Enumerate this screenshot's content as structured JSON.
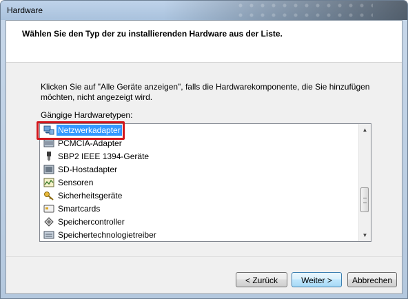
{
  "window": {
    "title": "Hardware"
  },
  "header": {
    "title": "Wählen Sie den Typ der zu installierenden Hardware aus der Liste."
  },
  "instruction": "Klicken Sie auf \"Alle Geräte anzeigen\", falls die Hardwarekomponente, die Sie hinzufügen möchten, nicht angezeigt wird.",
  "list": {
    "label": "Gängige Hardwaretypen:",
    "items": [
      {
        "label": "Netzwerkadapter",
        "icon": "network-adapter-icon",
        "selected": true
      },
      {
        "label": "PCMCIA-Adapter",
        "icon": "pcmcia-icon",
        "selected": false
      },
      {
        "label": "SBP2 IEEE 1394-Geräte",
        "icon": "ieee1394-icon",
        "selected": false
      },
      {
        "label": "SD-Hostadapter",
        "icon": "sd-host-icon",
        "selected": false
      },
      {
        "label": "Sensoren",
        "icon": "sensor-icon",
        "selected": false
      },
      {
        "label": "Sicherheitsgeräte",
        "icon": "key-icon",
        "selected": false
      },
      {
        "label": "Smartcards",
        "icon": "smartcard-icon",
        "selected": false
      },
      {
        "label": "Speichercontroller",
        "icon": "storage-controller-icon",
        "selected": false
      },
      {
        "label": "Speichertechnologietreiber",
        "icon": "storage-driver-icon",
        "selected": false
      }
    ]
  },
  "buttons": {
    "back": "< Zurück",
    "next": "Weiter >",
    "cancel": "Abbrechen"
  },
  "colors": {
    "selection": "#3399ff",
    "highlight_frame": "#d2161c"
  }
}
